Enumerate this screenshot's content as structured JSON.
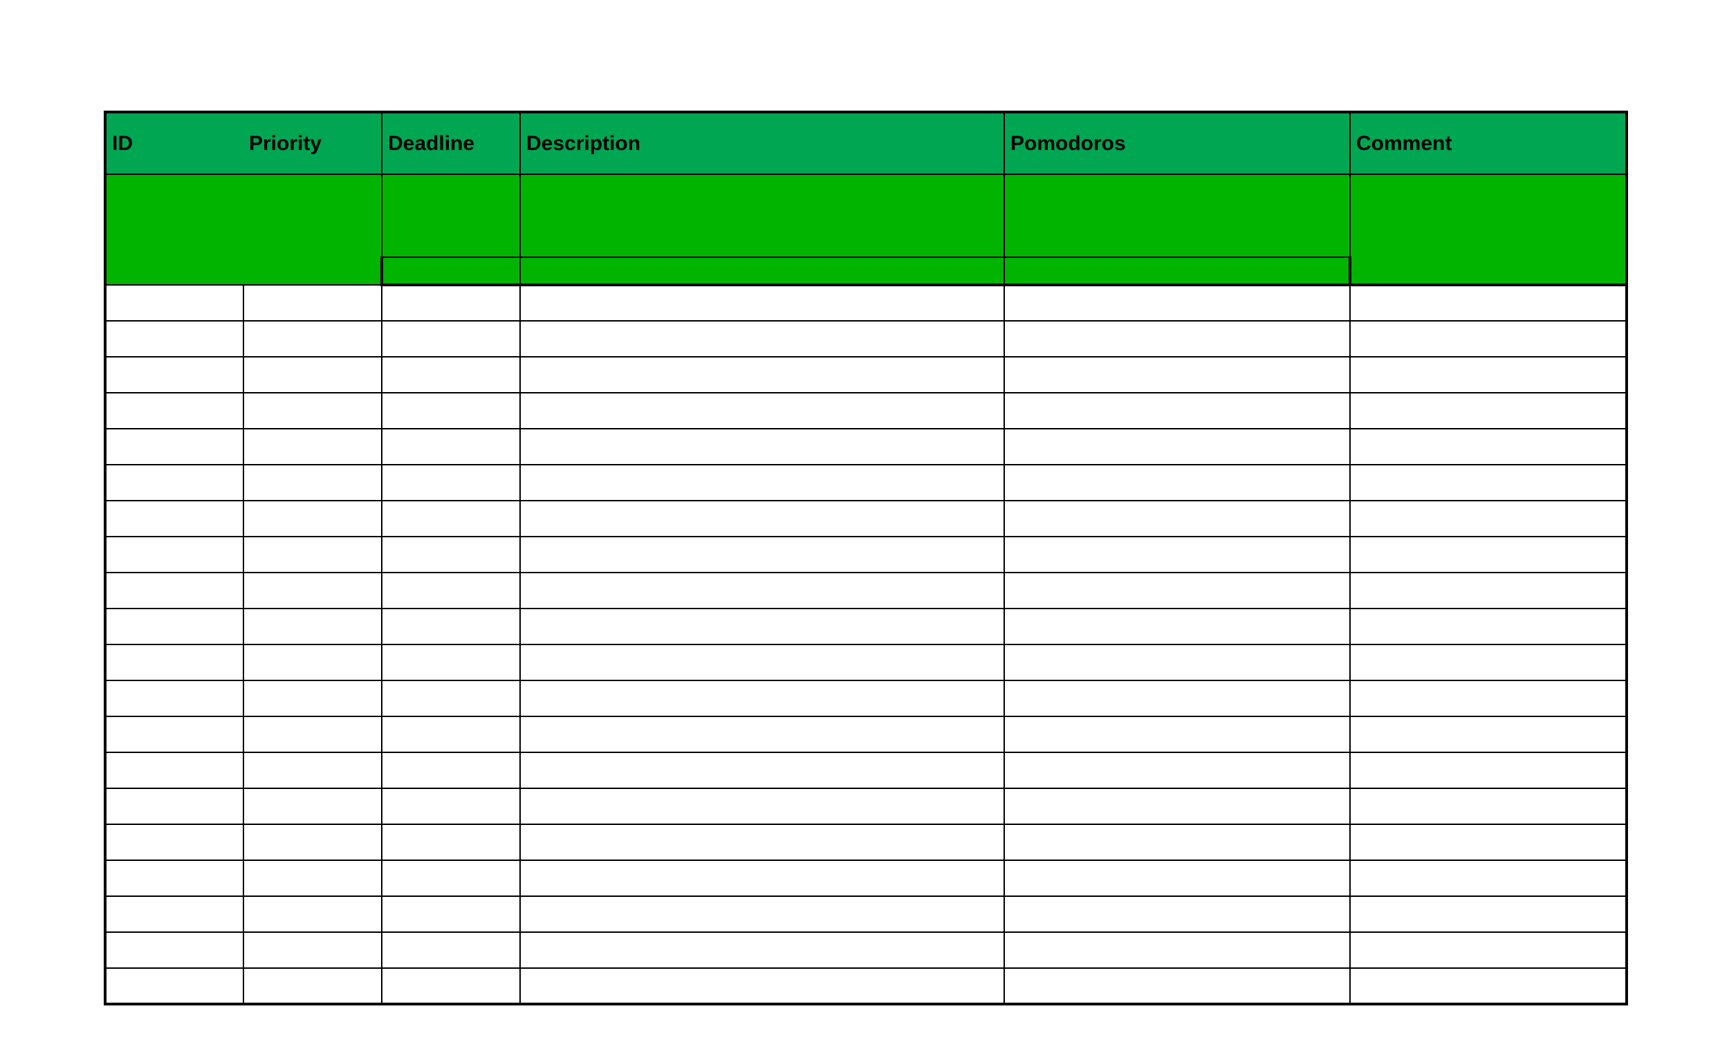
{
  "headers": {
    "id": "ID",
    "priority": "Priority",
    "deadline": "Deadline",
    "description": "Description",
    "pomodoros": "Pomodoros",
    "comment": "Comment"
  },
  "colors": {
    "header_green": "#00a651",
    "band_green": "#00b400",
    "border": "#000000",
    "page_bg": "#ffffff"
  },
  "rows": [
    {
      "id": "",
      "priority": "",
      "deadline": "",
      "description": "",
      "pomodoros": "",
      "comment": ""
    },
    {
      "id": "",
      "priority": "",
      "deadline": "",
      "description": "",
      "pomodoros": "",
      "comment": ""
    },
    {
      "id": "",
      "priority": "",
      "deadline": "",
      "description": "",
      "pomodoros": "",
      "comment": ""
    },
    {
      "id": "",
      "priority": "",
      "deadline": "",
      "description": "",
      "pomodoros": "",
      "comment": ""
    },
    {
      "id": "",
      "priority": "",
      "deadline": "",
      "description": "",
      "pomodoros": "",
      "comment": ""
    },
    {
      "id": "",
      "priority": "",
      "deadline": "",
      "description": "",
      "pomodoros": "",
      "comment": ""
    },
    {
      "id": "",
      "priority": "",
      "deadline": "",
      "description": "",
      "pomodoros": "",
      "comment": ""
    },
    {
      "id": "",
      "priority": "",
      "deadline": "",
      "description": "",
      "pomodoros": "",
      "comment": ""
    },
    {
      "id": "",
      "priority": "",
      "deadline": "",
      "description": "",
      "pomodoros": "",
      "comment": ""
    },
    {
      "id": "",
      "priority": "",
      "deadline": "",
      "description": "",
      "pomodoros": "",
      "comment": ""
    },
    {
      "id": "",
      "priority": "",
      "deadline": "",
      "description": "",
      "pomodoros": "",
      "comment": ""
    },
    {
      "id": "",
      "priority": "",
      "deadline": "",
      "description": "",
      "pomodoros": "",
      "comment": ""
    },
    {
      "id": "",
      "priority": "",
      "deadline": "",
      "description": "",
      "pomodoros": "",
      "comment": ""
    },
    {
      "id": "",
      "priority": "",
      "deadline": "",
      "description": "",
      "pomodoros": "",
      "comment": ""
    },
    {
      "id": "",
      "priority": "",
      "deadline": "",
      "description": "",
      "pomodoros": "",
      "comment": ""
    },
    {
      "id": "",
      "priority": "",
      "deadline": "",
      "description": "",
      "pomodoros": "",
      "comment": ""
    },
    {
      "id": "",
      "priority": "",
      "deadline": "",
      "description": "",
      "pomodoros": "",
      "comment": ""
    },
    {
      "id": "",
      "priority": "",
      "deadline": "",
      "description": "",
      "pomodoros": "",
      "comment": ""
    },
    {
      "id": "",
      "priority": "",
      "deadline": "",
      "description": "",
      "pomodoros": "",
      "comment": ""
    },
    {
      "id": "",
      "priority": "",
      "deadline": "",
      "description": "",
      "pomodoros": "",
      "comment": ""
    }
  ]
}
